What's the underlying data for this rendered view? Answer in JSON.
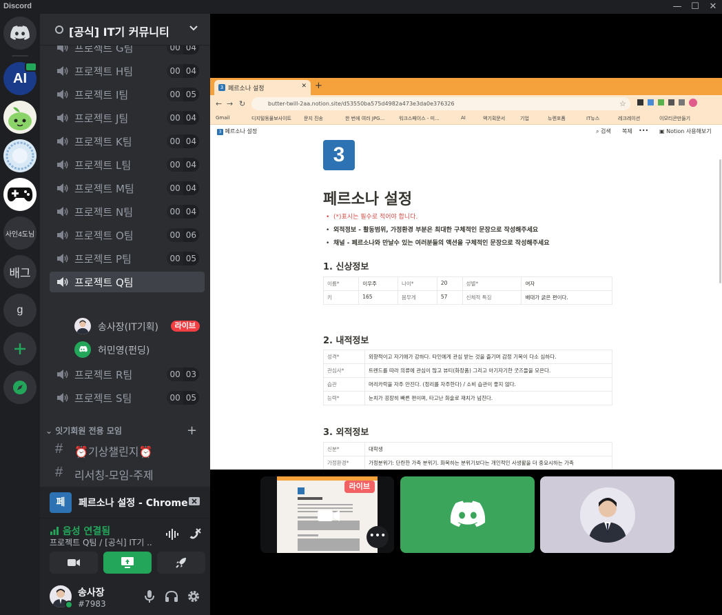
{
  "app": {
    "title": "Discord"
  },
  "servers": [
    {
      "name": "AI",
      "color": "#1a3a8a"
    },
    {
      "name": "ody",
      "color": "#f2f2e8"
    },
    {
      "name": "circle",
      "color": "#d9e8f5"
    },
    {
      "name": "game",
      "color": "#ffffff"
    },
    {
      "name": "사인4도님",
      "color": "#313338"
    },
    {
      "name": "배그",
      "color": "#313338"
    },
    {
      "name": "g",
      "color": "#313338"
    }
  ],
  "guild": {
    "name": "[공식] IT기 커뮤니티"
  },
  "voice_channels": [
    {
      "name": "프로젝트 G팀",
      "count": "00",
      "limit": "04"
    },
    {
      "name": "프로젝트 H팀",
      "count": "00",
      "limit": "04"
    },
    {
      "name": "프로젝트 I팀",
      "count": "00",
      "limit": "05"
    },
    {
      "name": "프로젝트 J팀",
      "count": "00",
      "limit": "04"
    },
    {
      "name": "프로젝트 K팀",
      "count": "00",
      "limit": "04"
    },
    {
      "name": "프로젝트 L팀",
      "count": "00",
      "limit": "04"
    },
    {
      "name": "프로젝트 M팀",
      "count": "00",
      "limit": "04"
    },
    {
      "name": "프로젝트 N팀",
      "count": "00",
      "limit": "04"
    },
    {
      "name": "프로젝트 O팀",
      "count": "00",
      "limit": "06"
    },
    {
      "name": "프로젝트 P팀",
      "count": "00",
      "limit": "05"
    },
    {
      "name": "프로젝트 Q팀",
      "count": "",
      "limit": ""
    },
    {
      "name": "프로젝트 R팀",
      "count": "00",
      "limit": "03"
    },
    {
      "name": "프로젝트 S팀",
      "count": "00",
      "limit": "05"
    }
  ],
  "voice_users": [
    {
      "name": "송사장(IT기획)",
      "badge": "라이브"
    },
    {
      "name": "허민영(펀딩)"
    }
  ],
  "category": {
    "name": "잇기회원 전용 모임"
  },
  "text_channels": [
    {
      "name": "⏰기상챌린지⏰"
    },
    {
      "name": "리서칭-모임-주제"
    }
  ],
  "stream": {
    "icon_text": "페",
    "title": "페르소나 설정 - Chrome"
  },
  "voice": {
    "status": "음성 연결됨",
    "sub": "프로젝트 Q팀 / [공식] IT기 ..."
  },
  "user": {
    "name": "송사장",
    "tag": "#7983"
  },
  "browser": {
    "tab_title": "페르소나 설정",
    "url": "butter-twill-2aa.notion.site/d53550ba575d4982a473e3da0e376326",
    "bookmarks": [
      "Gmail",
      "디지털동물보사이트",
      "문지 진송",
      "한 번에 여러 JPG...",
      "워크스페이스 - 미...",
      "AI",
      "액기획문서",
      "기업",
      "뉴렌포폼",
      "IT뉴스",
      "레크레이션",
      "이모티콘만들기"
    ]
  },
  "notion": {
    "breadcrumb": "페르소나 설정",
    "search": "검색",
    "share": "복제",
    "try": "Notion 사용해보기",
    "icon": "3",
    "title": "페르소나 설정",
    "bullets": [
      "(*)표시는 필수로 적어야 합니다.",
      "외적정보 - 활동범위, 가정환경 부분은 최대한 구체적인 문장으로 작성해주세요",
      "채널 - 페르소나와 만날수 있는 여러분들의 액션을 구체적인 문장으로 작성해주세요"
    ],
    "h_profile": "1. 신상정보",
    "profile_rows": [
      [
        "이름*",
        "이우주",
        "나이*",
        "20",
        "성별*",
        "여자"
      ],
      [
        "키",
        "165",
        "몸무게",
        "57",
        "신체적 특징",
        "배대가 굵은 편이다."
      ]
    ],
    "h_inner": "2. 내적정보",
    "inner_rows": [
      [
        "성격*",
        "외향적이고 자기애가 강하다. 타인에게 관심 받는 것을 즐기며 감정 기복이 다소 심하다."
      ],
      [
        "관심사*",
        "트렌드를 따라 의류에 관심이 많고 뷰티(화장품) 그리고 아기자기한 굿즈들을 모은다."
      ],
      [
        "습관",
        "머리카락을 자주 만진다. (정리를 자주한다) / 소비 습관이 좋지 않다."
      ],
      [
        "능력*",
        "눈치가 굉장히 빠른 편이며, 타고난 화술로 재치가 넘친다."
      ]
    ],
    "h_outer": "3. 외적정보",
    "outer_rows": [
      [
        "신분*",
        "대학생"
      ],
      [
        "가정환경*",
        "가정분위기: 단란한 가족 분위기. 화목하는 분위기보다는 개인적인 사생활을 더 중요시하는 가족"
      ]
    ]
  },
  "tiles": {
    "live": "라이브",
    "more": "•••"
  },
  "colors": {
    "green": "#23a55a",
    "red": "#f23f43",
    "blurple": "#5865f2",
    "notion_blue": "#2d73b3"
  }
}
